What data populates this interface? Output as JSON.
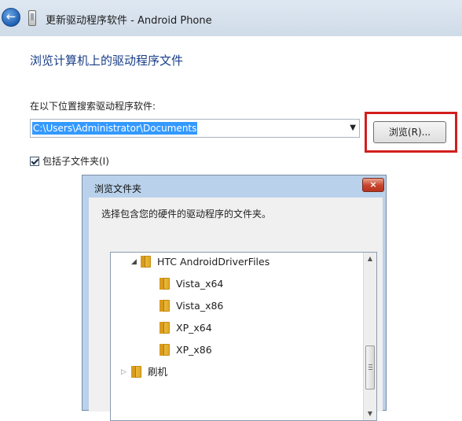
{
  "window": {
    "title": "更新驱动程序软件 - Android Phone",
    "heading": "浏览计算机上的驱动程序文件",
    "search_label": "在以下位置搜索驱动程序软件:",
    "path_value": "C:\\Users\\Administrator\\Documents",
    "browse_label": "浏览(R)...",
    "include_subfolders_label": "包括子文件夹(I)",
    "include_subfolders_checked": true,
    "highlight_color": "#d21e1e"
  },
  "dialog": {
    "title": "浏览文件夹",
    "prompt": "选择包含您的硬件的驱动程序的文件夹。",
    "close_label": "×",
    "tree": [
      {
        "label": "HTC AndroidDriverFiles",
        "expanded": true
      },
      {
        "label": "Vista_x64"
      },
      {
        "label": "Vista_x86"
      },
      {
        "label": "XP_x64"
      },
      {
        "label": "XP_x86"
      },
      {
        "label": "刷机",
        "expanded": false
      }
    ]
  },
  "icons": {
    "back": "back-arrow-icon",
    "device": "phone-device-icon",
    "folder": "folder-icon",
    "dropdown": "chevron-down-icon",
    "close": "close-icon"
  }
}
